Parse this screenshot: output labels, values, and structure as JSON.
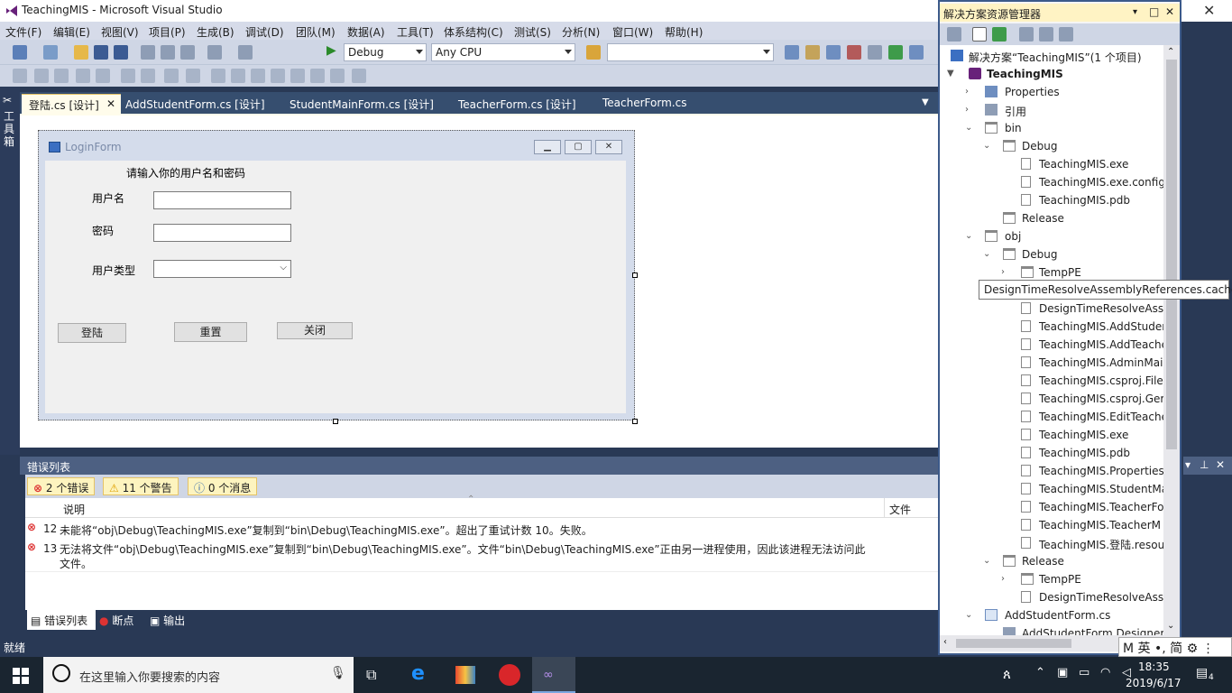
{
  "window_title": "TeachingMIS - Microsoft Visual Studio",
  "menu": [
    "文件(F)",
    "编辑(E)",
    "视图(V)",
    "项目(P)",
    "生成(B)",
    "调试(D)",
    "团队(M)",
    "数据(A)",
    "工具(T)",
    "体系结构(C)",
    "测试(S)",
    "分析(N)",
    "窗口(W)",
    "帮助(H)"
  ],
  "toolbar": {
    "config": "Debug",
    "platform": "Any CPU",
    "find": ""
  },
  "left_tool": "工具箱",
  "tabs": [
    {
      "label": "登陆.cs [设计]",
      "active": true
    },
    {
      "label": "AddStudentForm.cs [设计]"
    },
    {
      "label": "StudentMainForm.cs [设计]"
    },
    {
      "label": "TeacherForm.cs [设计]"
    },
    {
      "label": "TeacherForm.cs"
    }
  ],
  "form": {
    "title": "LoginForm",
    "prompt": "请输入你的用户名和密码",
    "username_label": "用户名",
    "password_label": "密码",
    "usertype_label": "用户类型",
    "login_button": "登陆",
    "reset_button": "重置",
    "close_button": "关闭"
  },
  "error_list": {
    "title": "错误列表",
    "errors_tab": "2 个错误",
    "warnings_tab": "11 个警告",
    "messages_tab": "0 个消息",
    "col_desc": "说明",
    "col_file": "文件",
    "rows": [
      {
        "num": "12",
        "text": "未能将“obj\\Debug\\TeachingMIS.exe”复制到“bin\\Debug\\TeachingMIS.exe”。超出了重试计数 10。失败。"
      },
      {
        "num": "13",
        "text": "无法将文件“obj\\Debug\\TeachingMIS.exe”复制到“bin\\Debug\\TeachingMIS.exe”。文件“bin\\Debug\\TeachingMIS.exe”正由另一进程使用，因此该进程无法访问此文件。"
      }
    ]
  },
  "bottom_tabs": [
    "错误列表",
    "断点",
    "输出"
  ],
  "status": "就绪",
  "solution_explorer": {
    "title": "解决方案资源管理器",
    "tooltip": "DesignTimeResolveAssemblyReferences.cache",
    "items": [
      {
        "text": "解决方案“TeachingMIS”(1 个项目)",
        "kind": "solution"
      },
      {
        "text": "TeachingMIS",
        "kind": "project"
      },
      {
        "text": "Properties",
        "kind": "props"
      },
      {
        "text": "引用",
        "kind": "ref"
      },
      {
        "text": "bin",
        "kind": "folder"
      },
      {
        "text": "Debug",
        "kind": "folder"
      },
      {
        "text": "TeachingMIS.exe",
        "kind": "file"
      },
      {
        "text": "TeachingMIS.exe.config",
        "kind": "file"
      },
      {
        "text": "TeachingMIS.pdb",
        "kind": "file"
      },
      {
        "text": "Release",
        "kind": "folder"
      },
      {
        "text": "obj",
        "kind": "folder"
      },
      {
        "text": "Debug",
        "kind": "folder"
      },
      {
        "text": "TempPE",
        "kind": "folder"
      },
      {
        "text": "DesignTimeResolveAssemblyReferences.cache",
        "kind": "file"
      },
      {
        "text": "DesignTimeResolveAsse",
        "kind": "file"
      },
      {
        "text": "TeachingMIS.AddStuden",
        "kind": "file"
      },
      {
        "text": "TeachingMIS.AddTeache",
        "kind": "file"
      },
      {
        "text": "TeachingMIS.AdminMai",
        "kind": "file"
      },
      {
        "text": "TeachingMIS.csproj.File",
        "kind": "file"
      },
      {
        "text": "TeachingMIS.csproj.Ger",
        "kind": "file"
      },
      {
        "text": "TeachingMIS.EditTeache",
        "kind": "file"
      },
      {
        "text": "TeachingMIS.exe",
        "kind": "file"
      },
      {
        "text": "TeachingMIS.pdb",
        "kind": "file"
      },
      {
        "text": "TeachingMIS.Properties",
        "kind": "file"
      },
      {
        "text": "TeachingMIS.StudentMa",
        "kind": "file"
      },
      {
        "text": "TeachingMIS.TeacherFo",
        "kind": "file"
      },
      {
        "text": "TeachingMIS.TeacherM",
        "kind": "file"
      },
      {
        "text": "TeachingMIS.登陆.resou",
        "kind": "file"
      },
      {
        "text": "Release",
        "kind": "folder"
      },
      {
        "text": "TempPE",
        "kind": "folder"
      },
      {
        "text": "DesignTimeResolveAsse",
        "kind": "file"
      },
      {
        "text": "AddStudentForm.cs",
        "kind": "cs"
      },
      {
        "text": "AddStudentForm.Designer",
        "kind": "file"
      }
    ]
  },
  "taskbar": {
    "search_placeholder": "在这里输入你要搜索的内容",
    "time": "18:35",
    "date": "2019/6/17",
    "notifications": "4",
    "ime": "M 英 •, 简 ⚙ ⋮"
  },
  "colors": {
    "vs_bg": "#293955",
    "accent": "#fdf4bf",
    "tab_active": "#fffceb"
  }
}
